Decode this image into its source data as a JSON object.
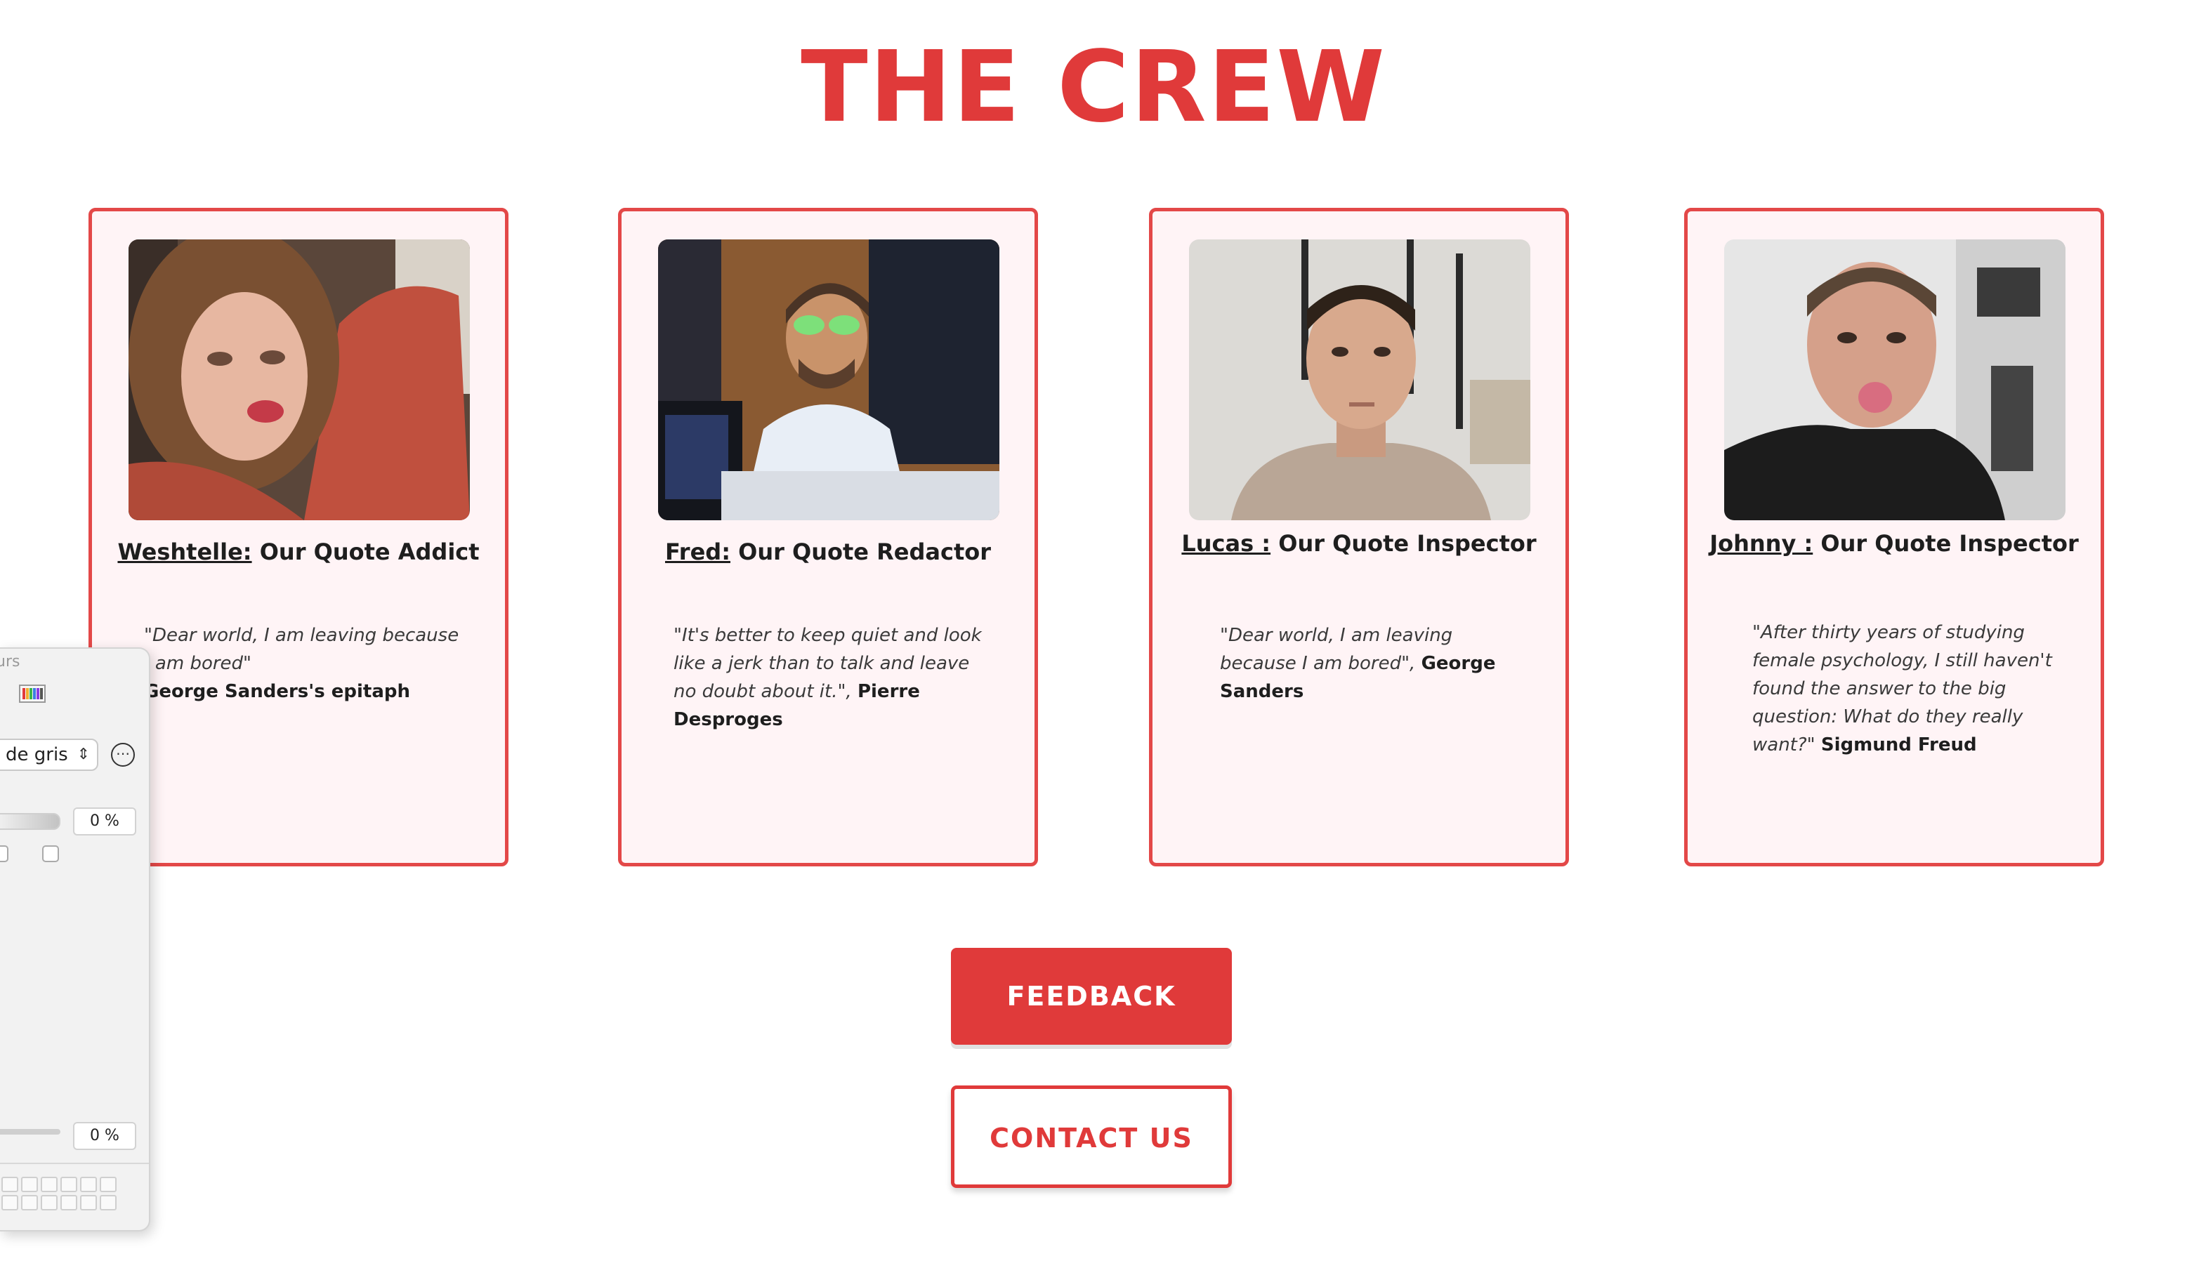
{
  "page": {
    "title": "THE CREW",
    "accent_color": "#e03a3a",
    "card_background": "#fff4f6"
  },
  "crew": [
    {
      "name": "Weshtelle:",
      "role": " Our Quote Addict",
      "quote": "\"Dear world, I am leaving because I am bored\"",
      "author": "George Sanders's epitaph",
      "photo": "woman-selfie-photo"
    },
    {
      "name": "Fred:",
      "role": " Our Quote Redactor",
      "quote": "\"It's better to keep quiet and look like a jerk than to talk and leave no doubt about it.\",",
      "author": "Pierre Desproges",
      "photo": "man-at-desk-photo"
    },
    {
      "name": "Lucas :",
      "role": " Our Quote Inspector",
      "quote": "\"Dear world, I am leaving because I am bored\",",
      "author": "George Sanders",
      "photo": "man-portrait-photo"
    },
    {
      "name": "Johnny :",
      "role": " Our Quote Inspector",
      "quote": "\"After thirty years of studying female psychology, I still haven't found the answer to the big question: What do they really want?\"",
      "author": "Sigmund Freud",
      "photo": "man-tongue-photo"
    }
  ],
  "buttons": {
    "feedback": "FEEDBACK",
    "contact": "CONTACT US"
  },
  "color_panel": {
    "title_fragment": "urs",
    "mode_value": "de gris",
    "top_percent": "0 %",
    "bottom_percent": "0 %",
    "icons": [
      "color-sliders-icon",
      "color-palettes-icon",
      "more-options-icon",
      "chevron-updown-icon"
    ]
  }
}
